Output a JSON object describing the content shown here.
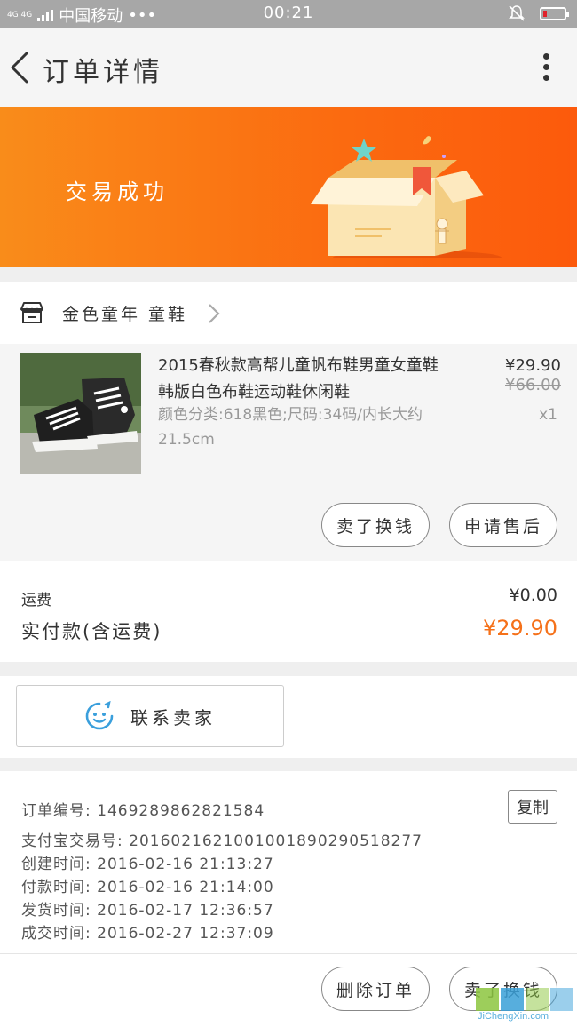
{
  "status_bar": {
    "signal": "4G 4G",
    "carrier": "中国移动",
    "dots": "•••",
    "time": "00:21"
  },
  "navbar": {
    "title": "订单详情"
  },
  "banner": {
    "status": "交易成功"
  },
  "shop": {
    "name": "金色童年 童鞋"
  },
  "product": {
    "title": "2015春秋款高帮儿童帆布鞋男童女童鞋韩版白色布鞋运动鞋休闲鞋",
    "sku": "颜色分类:618黑色;尺码:34码/内长大约21.5cm",
    "price": "¥29.90",
    "original_price": "¥66.00",
    "quantity": "x1",
    "actions": {
      "resell": "卖了换钱",
      "after_sale": "申请售后"
    }
  },
  "fees": {
    "shipping_label": "运费",
    "shipping_value": "¥0.00",
    "paid_label": "实付款(含运费)",
    "paid_value": "¥29.90",
    "accent_color": "#f5711a"
  },
  "contact": {
    "label": "联系卖家"
  },
  "order_info": {
    "order_no": "订单编号: 1469289862821584",
    "copy_label": "复制",
    "alipay_no": "支付宝交易号: 2016021621001001890290518277",
    "created": "创建时间: 2016-02-16 21:13:27",
    "paid": "付款时间: 2016-02-16 21:14:00",
    "shipped": "发货时间: 2016-02-17 12:36:57",
    "completed": "成交时间: 2016-02-27 12:37:09"
  },
  "bottom_bar": {
    "delete": "删除订单",
    "resell": "卖了换钱"
  },
  "watermark": {
    "text": "JiChengXin.com"
  }
}
